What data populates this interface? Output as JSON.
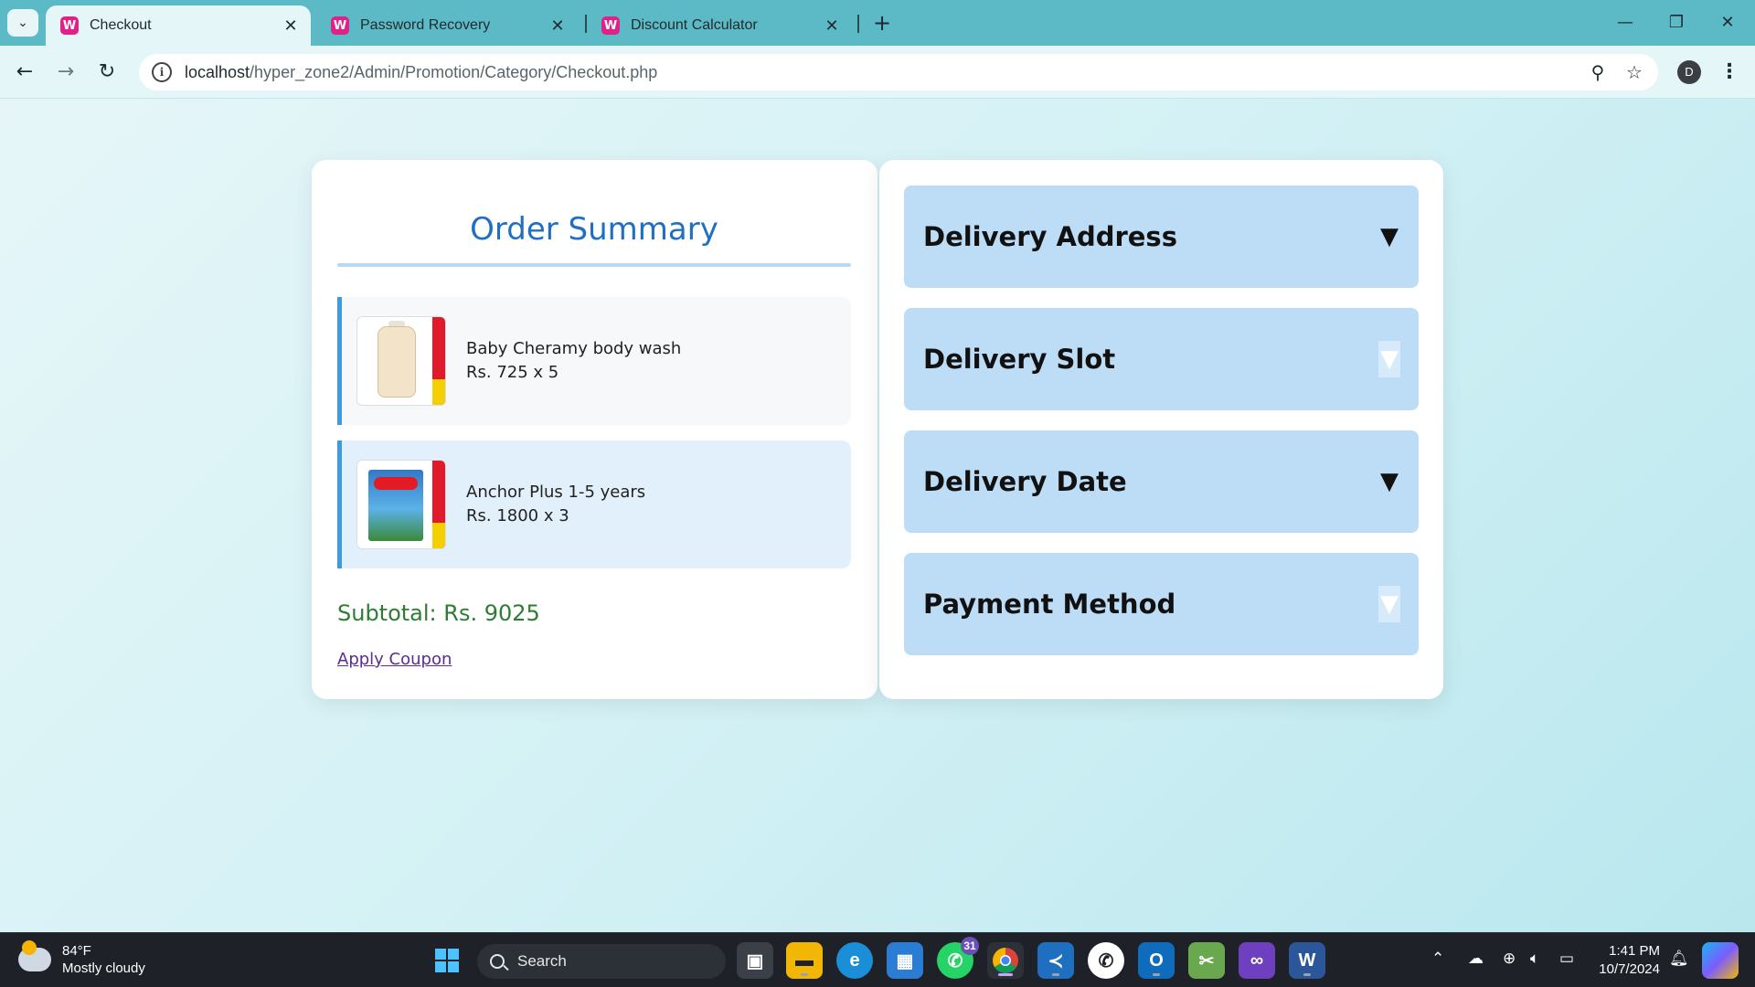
{
  "browser": {
    "tabs": [
      {
        "title": "Checkout",
        "active": true
      },
      {
        "title": "Password Recovery",
        "active": false
      },
      {
        "title": "Discount Calculator",
        "active": false
      }
    ],
    "url_host": "localhost",
    "url_path": "/hyper_zone2/Admin/Promotion/Category/Checkout.php",
    "profile_initial": "D"
  },
  "order_summary": {
    "title": "Order Summary",
    "items": [
      {
        "name": "Baby Cheramy body wash",
        "price_line": "Rs. 725 x 5"
      },
      {
        "name": "Anchor Plus 1-5 years",
        "price_line": "Rs. 1800 x 3"
      }
    ],
    "subtotal": "Subtotal: Rs. 9025",
    "coupon_link": "Apply Coupon"
  },
  "sections": [
    {
      "title": "Delivery Address",
      "arrow": "▼"
    },
    {
      "title": "Delivery Slot",
      "arrow": "▼"
    },
    {
      "title": "Delivery Date",
      "arrow": "▼"
    },
    {
      "title": "Payment Method",
      "arrow": "▼"
    }
  ],
  "taskbar": {
    "weather_temp": "84°F",
    "weather_desc": "Mostly cloudy",
    "search_label": "Search",
    "whatsapp_badge": "31",
    "time": "1:41 PM",
    "date": "10/7/2024"
  },
  "colors": {
    "accent_title": "#1f6fc2",
    "subtotal": "#2e7d32",
    "section_bg": "#bddcf6",
    "tab_strip": "#5cb9c6"
  }
}
